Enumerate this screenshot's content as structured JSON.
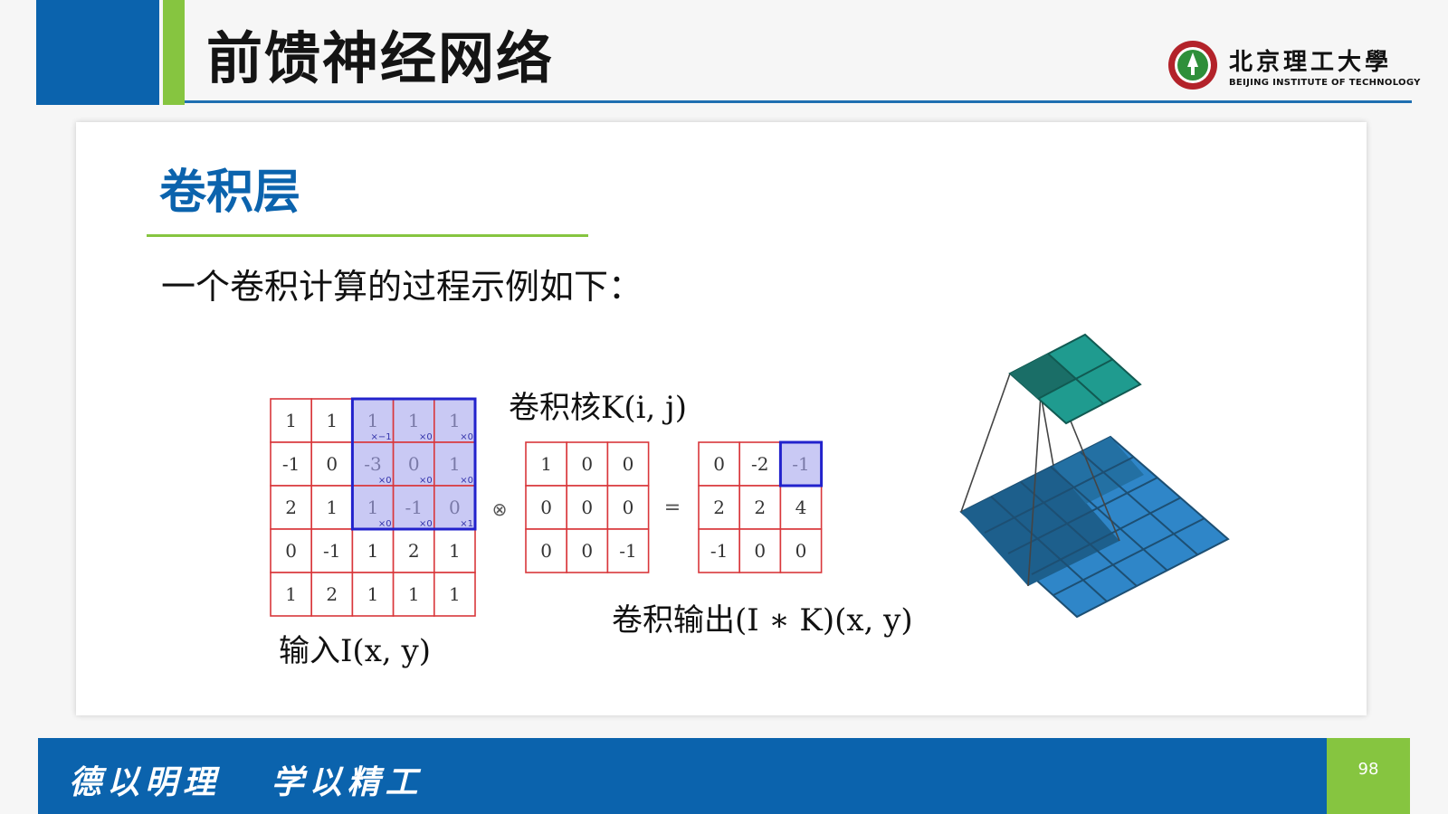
{
  "header": {
    "title": "前馈神经网络"
  },
  "logo": {
    "name_cn": "北京理工大學",
    "name_en": "BEIJING INSTITUTE OF TECHNOLOGY"
  },
  "section": {
    "title": "卷积层"
  },
  "description": "一个卷积计算的过程示例如下：",
  "input_matrix": {
    "rows": [
      [
        "1",
        "1",
        "1",
        "1",
        "1"
      ],
      [
        "-1",
        "0",
        "-3",
        "0",
        "1"
      ],
      [
        "2",
        "1",
        "1",
        "-1",
        "0"
      ],
      [
        "0",
        "-1",
        "1",
        "2",
        "1"
      ],
      [
        "1",
        "2",
        "1",
        "1",
        "1"
      ]
    ],
    "weights": [
      [
        "×−1",
        "×0",
        "×0"
      ],
      [
        "×0",
        "×0",
        "×0"
      ],
      [
        "×0",
        "×0",
        "×1"
      ]
    ],
    "caption": "输入I(x, y)"
  },
  "kernel_matrix": {
    "rows": [
      [
        "1",
        "0",
        "0"
      ],
      [
        "0",
        "0",
        "0"
      ],
      [
        "0",
        "0",
        "-1"
      ]
    ],
    "caption": "卷积核K(i, j)"
  },
  "output_matrix": {
    "rows": [
      [
        "0",
        "-2",
        "-1"
      ],
      [
        "2",
        "2",
        "4"
      ],
      [
        "-1",
        "0",
        "0"
      ]
    ],
    "caption": "卷积输出(I ∗ K)(x, y)"
  },
  "operators": {
    "convolve": "⊗",
    "equals": "="
  },
  "colors": {
    "brand_blue": "#0b63ad",
    "accent_green": "#86c540",
    "grid_red": "#d9373b",
    "highlight_border": "#2222cc",
    "highlight_fill": "#c9c9f4"
  },
  "footer": {
    "motto": "德以明理   学以精工",
    "page_number": "98"
  }
}
